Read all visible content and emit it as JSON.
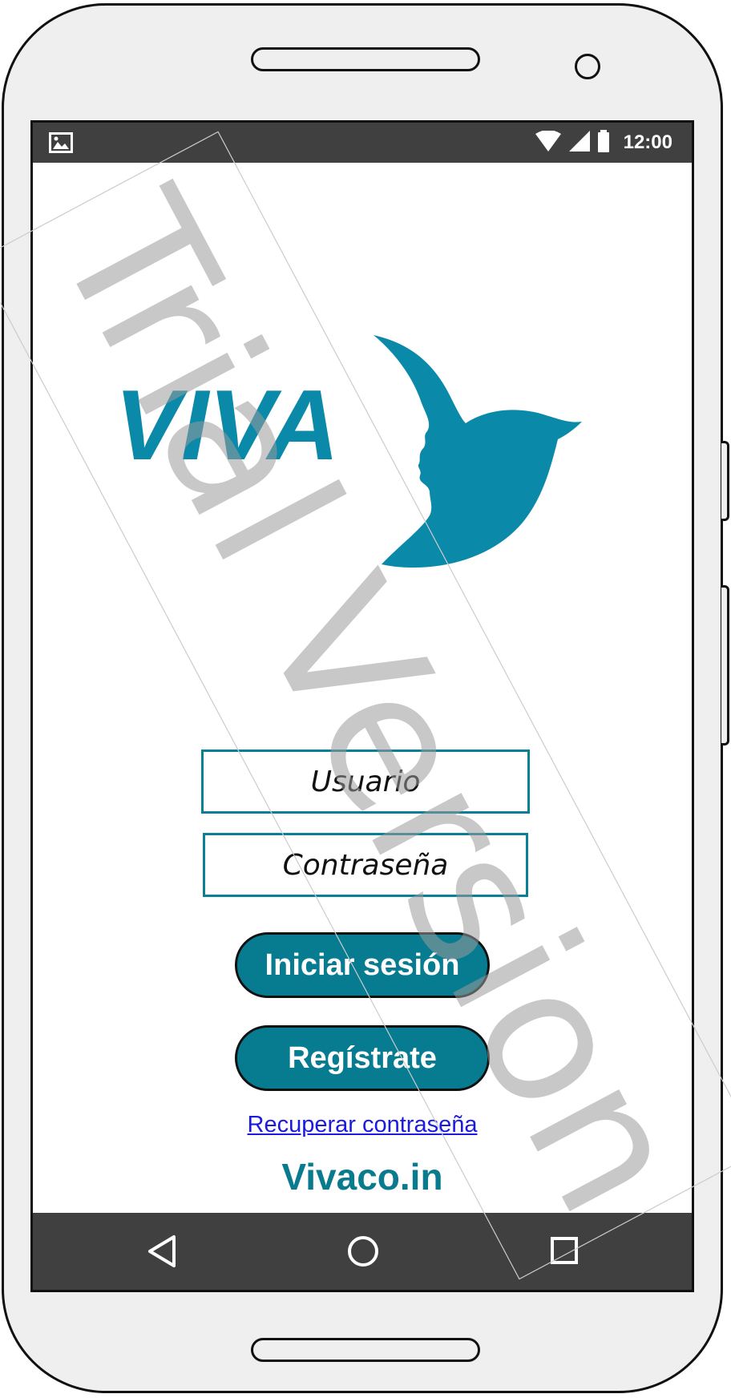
{
  "status_bar": {
    "time": "12:00",
    "icons": [
      "image-icon",
      "wifi-icon",
      "signal-icon",
      "battery-icon"
    ]
  },
  "logo": {
    "text": "VIVA",
    "color": "#0a8aa8"
  },
  "form": {
    "username_placeholder": "Usuario",
    "password_placeholder": "Contraseña"
  },
  "buttons": {
    "login": "Iniciar sesión",
    "register": "Regístrate"
  },
  "links": {
    "recover_password": "Recuperar contraseña"
  },
  "footer": {
    "site": "Vivaco.in"
  },
  "navigation": {
    "icons": [
      "back-icon",
      "home-icon",
      "recent-apps-icon"
    ]
  },
  "watermark": {
    "text": "Trial Version"
  },
  "colors": {
    "accent": "#077c91",
    "bars": "#404040",
    "link": "#1a1ae0"
  }
}
